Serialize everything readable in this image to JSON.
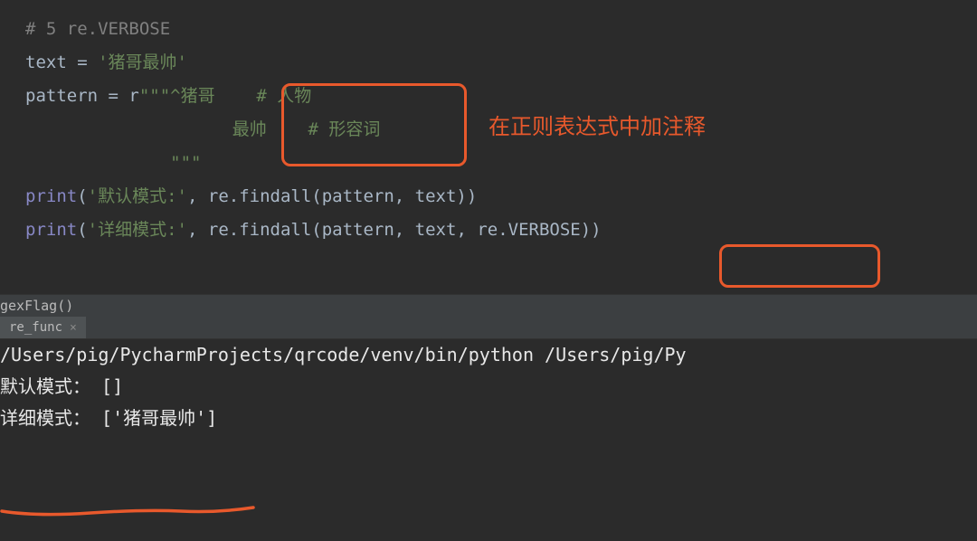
{
  "code": {
    "c1": "# 5 re.VERBOSE",
    "l2_var": "text",
    "l2_eq": " = ",
    "l2_str": "'猪哥最帅'",
    "l3_var": "pattern",
    "l3_eq": " = ",
    "l3_prefix": "r",
    "l3_str1": "\"\"\"^猪哥    # 人物",
    "l4_str": "                    最帅    # 形容词",
    "l5_str": "              \"\"\"",
    "l6_print": "print",
    "l6_open": "(",
    "l6_str": "'默认模式:'",
    "l6_comma": ", ",
    "l6_re": "re.findall(pattern",
    "l6_comma2": ", ",
    "l6_text": "text))",
    "l7_print": "print",
    "l7_open": "(",
    "l7_str": "'详细模式:'",
    "l7_comma": ", ",
    "l7_re": "re.findall(pattern",
    "l7_comma2": ", ",
    "l7_text": "text",
    "l7_comma3": ", ",
    "l7_verbose": "re.VERBOSE))"
  },
  "annotation": "在正则表达式中加注释",
  "run": {
    "header": "gexFlag()",
    "tab": "re_func",
    "console_l1": "/Users/pig/PycharmProjects/qrcode/venv/bin/python /Users/pig/Py",
    "console_l2": "默认模式： []",
    "console_l3": "详细模式： ['猪哥最帅']"
  }
}
